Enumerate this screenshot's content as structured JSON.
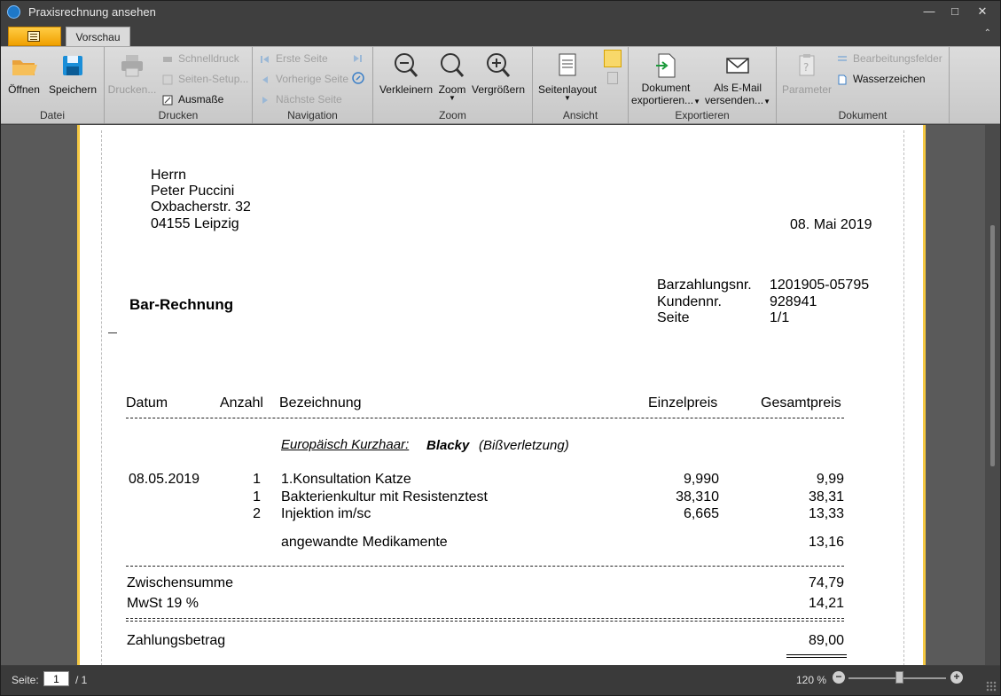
{
  "window": {
    "title": "Praxisrechnung ansehen",
    "minimize": "—",
    "maximize": "□",
    "close": "✕"
  },
  "ribbon": {
    "tab": "Vorschau",
    "collapse": "⌃",
    "groups": {
      "datei": {
        "label": "Datei",
        "open": "Öffnen",
        "save": "Speichern"
      },
      "drucken": {
        "label": "Drucken",
        "print": "Drucken...",
        "quickprint": "Schnelldruck",
        "pagesetup": "Seiten-Setup...",
        "dimensions": "Ausmaße"
      },
      "navigation": {
        "label": "Navigation",
        "first": "Erste Seite",
        "prev": "Vorherige Seite",
        "next": "Nächste Seite"
      },
      "zoom": {
        "label": "Zoom",
        "zoomout": "Verkleinern",
        "zoom": "Zoom",
        "zoomin": "Vergrößern"
      },
      "ansicht": {
        "label": "Ansicht",
        "pagelayout": "Seitenlayout"
      },
      "exportieren": {
        "label": "Exportieren",
        "export_line1": "Dokument",
        "export_line2": "exportieren...",
        "email_line1": "Als E-Mail",
        "email_line2": "versenden..."
      },
      "dokument": {
        "label": "Dokument",
        "parameter": "Parameter",
        "editfields": "Bearbeitungsfelder",
        "watermark": "Wasserzeichen"
      }
    }
  },
  "invoice": {
    "address": [
      "Herrn",
      "Peter Puccini",
      "Oxbacherstr. 32",
      "04155 Leipzig"
    ],
    "date": "08. Mai 2019",
    "title": "Bar-Rechnung",
    "meta": [
      {
        "label": "Barzahlungsnr.",
        "value": "1201905-05795"
      },
      {
        "label": "Kundennr.",
        "value": "928941"
      },
      {
        "label": "Seite",
        "value": "1/1"
      }
    ],
    "headers": {
      "date": "Datum",
      "qty": "Anzahl",
      "desc": "Bezeichnung",
      "unit": "Einzelpreis",
      "total": "Gesamtpreis"
    },
    "patient": {
      "species": "Europäisch Kurzhaar:",
      "name": "Blacky",
      "reason": "(Bißverletzung)"
    },
    "rows": [
      {
        "date": "08.05.2019",
        "qty": "1",
        "desc": "1.Konsultation Katze",
        "unit": "9,990",
        "total": "9,99"
      },
      {
        "date": "",
        "qty": "1",
        "desc": "Bakterienkultur mit Resistenztest",
        "unit": "38,310",
        "total": "38,31"
      },
      {
        "date": "",
        "qty": "2",
        "desc": "Injektion im/sc",
        "unit": "6,665",
        "total": "13,33"
      }
    ],
    "meds": {
      "label": "angewandte Medikamente",
      "total": "13,16"
    },
    "subtotal": {
      "label": "Zwischensumme",
      "value": "74,79"
    },
    "vat": {
      "label": "MwSt 19 %",
      "value": "14,21"
    },
    "payment": {
      "label": "Zahlungsbetrag",
      "value": "89,00"
    }
  },
  "status": {
    "page_label": "Seite:",
    "page_value": "1",
    "page_total": "/ 1",
    "zoom": "120 %",
    "zoom_out": "−",
    "zoom_in": "+"
  }
}
